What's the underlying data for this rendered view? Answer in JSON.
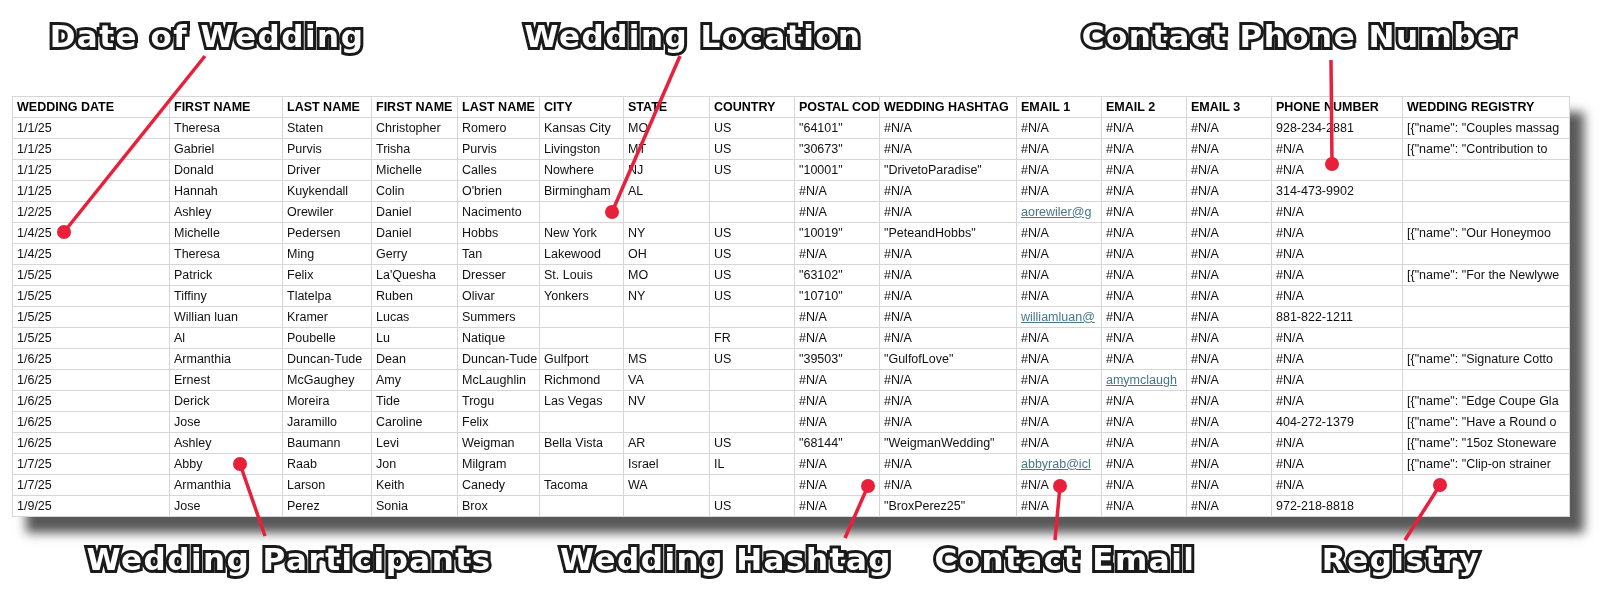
{
  "table": {
    "columns": [
      "WEDDING DATE",
      "FIRST NAME",
      "LAST NAME",
      "FIRST NAME",
      "LAST NAME",
      "CITY",
      "STATE",
      "COUNTRY",
      "POSTAL COD",
      "WEDDING HASHTAG",
      "EMAIL 1",
      "EMAIL 2",
      "EMAIL 3",
      "PHONE NUMBER",
      "WEDDING REGISTRY"
    ],
    "rows": [
      [
        "1/1/25",
        "Theresa",
        "Staten",
        "Christopher",
        "Romero",
        "Kansas City",
        "MO",
        "US",
        "\"64101\"",
        "#N/A",
        "#N/A",
        "#N/A",
        "#N/A",
        "928-234-2881",
        "[{\"name\": \"Couples massag"
      ],
      [
        "1/1/25",
        "Gabriel",
        "Purvis",
        "Trisha",
        "Purvis",
        "Livingston",
        "MT",
        "US",
        "\"30673\"",
        "#N/A",
        "#N/A",
        "#N/A",
        "#N/A",
        "#N/A",
        "[{\"name\": \"Contribution to"
      ],
      [
        "1/1/25",
        "Donald",
        "Driver",
        "Michelle",
        "Calles",
        "Nowhere",
        "NJ",
        "US",
        "\"10001\"",
        "\"DrivetoParadise\"",
        "#N/A",
        "#N/A",
        "#N/A",
        "#N/A",
        null
      ],
      [
        "1/1/25",
        "Hannah",
        "Kuykendall",
        "Colin",
        "O'brien",
        "Birmingham",
        "AL",
        null,
        "#N/A",
        "#N/A",
        "#N/A",
        "#N/A",
        "#N/A",
        "314-473-9902",
        null
      ],
      [
        "1/2/25",
        "Ashley",
        "Orewiler",
        "Daniel",
        "Nacimento",
        null,
        null,
        null,
        "#N/A",
        "#N/A",
        {
          "text": "aorewiler@g",
          "kind": "link"
        },
        "#N/A",
        "#N/A",
        "#N/A",
        null
      ],
      [
        "1/4/25",
        "Michelle",
        "Pedersen",
        "Daniel",
        "Hobbs",
        "New York",
        "NY",
        "US",
        "\"10019\"",
        "\"PeteandHobbs\"",
        "#N/A",
        "#N/A",
        "#N/A",
        "#N/A",
        "[{\"name\": \"Our Honeymoo"
      ],
      [
        "1/4/25",
        "Theresa",
        "Ming",
        "Gerry",
        "Tan",
        "Lakewood",
        "OH",
        "US",
        "#N/A",
        "#N/A",
        "#N/A",
        "#N/A",
        "#N/A",
        "#N/A",
        null
      ],
      [
        "1/5/25",
        "Patrick",
        "Felix",
        "La'Quesha",
        "Dresser",
        "St. Louis",
        "MO",
        "US",
        "\"63102\"",
        "#N/A",
        "#N/A",
        "#N/A",
        "#N/A",
        "#N/A",
        "[{\"name\": \"For the Newlywe"
      ],
      [
        "1/5/25",
        "Tiffiny",
        "Tlatelpa",
        "Ruben",
        "Olivar",
        "Yonkers",
        "NY",
        "US",
        "\"10710\"",
        "#N/A",
        "#N/A",
        "#N/A",
        "#N/A",
        "#N/A",
        null
      ],
      [
        "1/5/25",
        "Willian luan",
        "Kramer",
        "Lucas",
        "Summers",
        null,
        null,
        null,
        "#N/A",
        "#N/A",
        {
          "text": "williamluan@",
          "kind": "link"
        },
        "#N/A",
        "#N/A",
        "881-822-1211",
        null
      ],
      [
        "1/5/25",
        "Al",
        "Poubelle",
        "Lu",
        "Natique",
        null,
        null,
        "FR",
        "#N/A",
        "#N/A",
        "#N/A",
        "#N/A",
        "#N/A",
        "#N/A",
        null
      ],
      [
        "1/6/25",
        "Armanthia",
        "Duncan-Tude",
        "Dean",
        "Duncan-Tude",
        "Gulfport",
        "MS",
        "US",
        "\"39503\"",
        "\"GulfofLove\"",
        "#N/A",
        "#N/A",
        "#N/A",
        "#N/A",
        "[{\"name\": \"Signature Cotto"
      ],
      [
        "1/6/25",
        "Ernest",
        "McGaughey",
        "Amy",
        "McLaughlin",
        "Richmond",
        "VA",
        null,
        "#N/A",
        "#N/A",
        "#N/A",
        {
          "text": "amymclaugh",
          "kind": "link"
        },
        "#N/A",
        "#N/A",
        null
      ],
      [
        "1/6/25",
        "Derick",
        "Moreira",
        "Tide",
        "Trogu",
        "Las Vegas",
        "NV",
        null,
        "#N/A",
        "#N/A",
        "#N/A",
        "#N/A",
        "#N/A",
        "#N/A",
        "[{\"name\": \"Edge Coupe Gla"
      ],
      [
        "1/6/25",
        "Jose",
        "Jaramillo",
        "Caroline",
        "Felix",
        null,
        null,
        null,
        "#N/A",
        "#N/A",
        "#N/A",
        "#N/A",
        "#N/A",
        "404-272-1379",
        "[{\"name\": \"Have a Round o"
      ],
      [
        "1/6/25",
        "Ashley",
        "Baumann",
        "Levi",
        "Weigman",
        "Bella Vista",
        "AR",
        "US",
        "\"68144\"",
        "\"WeigmanWedding\"",
        "#N/A",
        "#N/A",
        "#N/A",
        "#N/A",
        "[{\"name\": \"15oz Stoneware"
      ],
      [
        "1/7/25",
        "Abby",
        "Raab",
        "Jon",
        "Milgram",
        null,
        "Israel",
        "IL",
        "#N/A",
        "#N/A",
        {
          "text": "abbyrab@icl",
          "kind": "link"
        },
        "#N/A",
        "#N/A",
        "#N/A",
        "[{\"name\": \"Clip-on strainer"
      ],
      [
        "1/7/25",
        "Armanthia",
        "Larson",
        "Keith",
        "Canedy",
        "Tacoma",
        "WA",
        null,
        "#N/A",
        "#N/A",
        "#N/A",
        "#N/A",
        "#N/A",
        "#N/A",
        null
      ],
      [
        "1/9/25",
        "Jose",
        "Perez",
        "Sonia",
        "Brox",
        null,
        null,
        "US",
        "#N/A",
        "\"BroxPerez25\"",
        "#N/A",
        "#N/A",
        "#N/A",
        "972-218-8818",
        null
      ]
    ]
  },
  "callouts": [
    "Date of Wedding",
    "Wedding Location",
    "Contact Phone Number",
    "Wedding Participants",
    "Wedding Hashtag",
    "Contact Email",
    "Registry"
  ]
}
